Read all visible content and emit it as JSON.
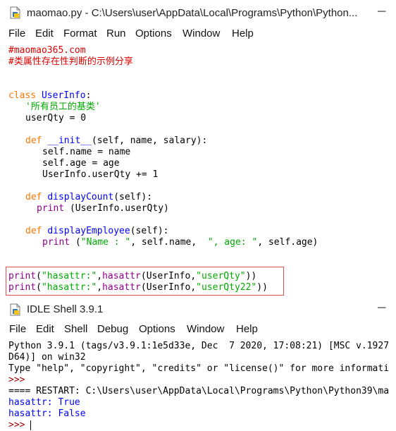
{
  "editor_window": {
    "title": "maomao.py - C:\\Users\\user\\AppData\\Local\\Programs\\Python\\Python...",
    "minimize": "─",
    "menu": [
      "File",
      "Edit",
      "Format",
      "Run",
      "Options",
      "Window",
      "Help"
    ]
  },
  "code": {
    "line1": "#maomao365.com",
    "line2": "#类属性存在性判断的示例分享",
    "class_kw": "class",
    "class_name": "UserInfo",
    "colon": ":",
    "docstring": "'所有员工的基类'",
    "userqty": "userQty = 0",
    "def_kw": "def",
    "init_name": "__init__",
    "init_args": "(self, name, salary):",
    "self_name": "self.name = name",
    "self_age": "self.age = age",
    "inc": "UserInfo.userQty += 1",
    "dc_name": "displayCount",
    "dc_args": "(self):",
    "print_kw": "print",
    "dc_body": " (UserInfo.userQty)",
    "de_name": "displayEmployee",
    "de_args": "(self):",
    "de_open": " (",
    "de_s1": "\"Name : \"",
    "de_mid": ", self.name,  ",
    "de_s2": "\", age: \"",
    "de_end": ", self.age)",
    "p1_open": "(",
    "p1_s1": "\"hasattr:\"",
    "p1_comma": ",",
    "hasattr_kw": "hasattr",
    "p1_args": "(UserInfo,",
    "p1_s2": "\"userQty\"",
    "p1_close": "))",
    "p2_s2": "\"userQty22\""
  },
  "shell_window": {
    "title": "IDLE Shell 3.9.1",
    "minimize": "─",
    "menu": [
      "File",
      "Edit",
      "Shell",
      "Debug",
      "Options",
      "Window",
      "Help"
    ],
    "lines": {
      "l1": "Python 3.9.1 (tags/v3.9.1:1e5d33e, Dec  7 2020, 17:08:21) [MSC v.1927",
      "l2": "D64)] on win32",
      "l3": "Type \"help\", \"copyright\", \"credits\" or \"license()\" for more informati",
      "prompt": ">>>",
      "restart": "==== RESTART: C:\\Users\\user\\AppData\\Local\\Programs\\Python\\Python39\\ma",
      "out1": "hasattr: True",
      "out2": "hasattr: False"
    }
  }
}
